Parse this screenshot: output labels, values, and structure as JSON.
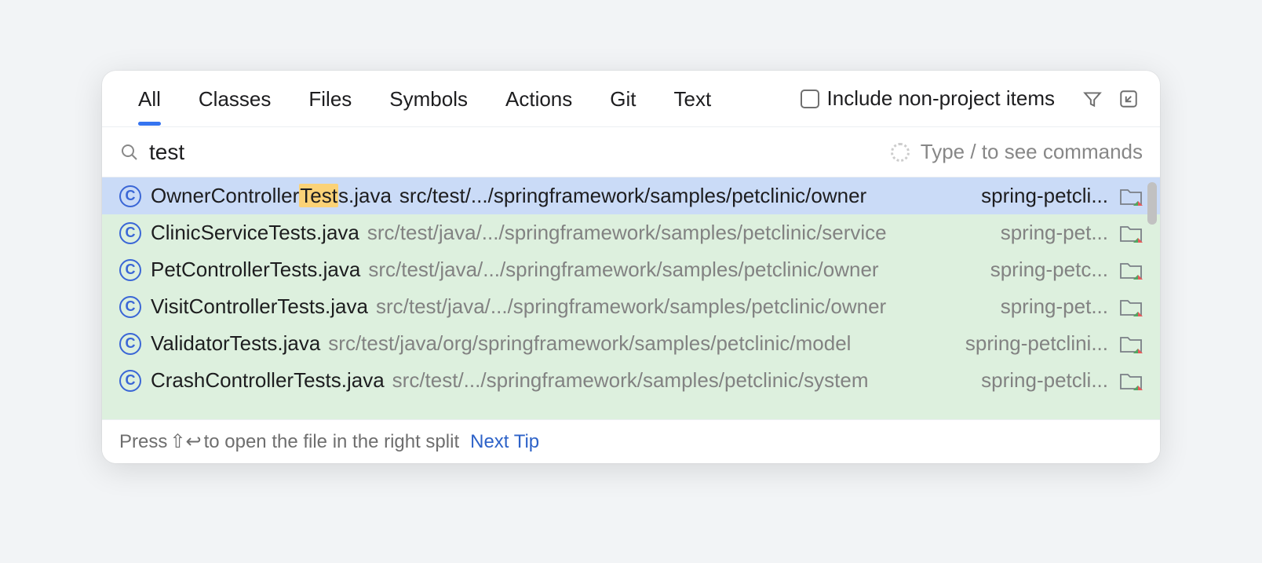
{
  "tabs": [
    "All",
    "Classes",
    "Files",
    "Symbols",
    "Actions",
    "Git",
    "Text"
  ],
  "active_tab_index": 0,
  "include_nonproject_label": "Include non-project items",
  "include_nonproject_checked": false,
  "search": {
    "value": "test",
    "hint": "Type / to see commands"
  },
  "results": [
    {
      "file_pre": "OwnerController",
      "file_match": "Test",
      "file_post": "s.java",
      "path": "src/test/.../springframework/samples/petclinic/owner",
      "module": "spring-petcli...",
      "selected": true
    },
    {
      "file_pre": "ClinicServiceTests.java",
      "file_match": "",
      "file_post": "",
      "path": "src/test/java/.../springframework/samples/petclinic/service",
      "module": "spring-pet...",
      "selected": false
    },
    {
      "file_pre": "PetControllerTests.java",
      "file_match": "",
      "file_post": "",
      "path": "src/test/java/.../springframework/samples/petclinic/owner",
      "module": "spring-petc...",
      "selected": false
    },
    {
      "file_pre": "VisitControllerTests.java",
      "file_match": "",
      "file_post": "",
      "path": "src/test/java/.../springframework/samples/petclinic/owner",
      "module": "spring-pet...",
      "selected": false
    },
    {
      "file_pre": "ValidatorTests.java",
      "file_match": "",
      "file_post": "",
      "path": "src/test/java/org/springframework/samples/petclinic/model",
      "module": "spring-petclini...",
      "selected": false
    },
    {
      "file_pre": "CrashControllerTests.java",
      "file_match": "",
      "file_post": "",
      "path": "src/test/.../springframework/samples/petclinic/system",
      "module": "spring-petcli...",
      "selected": false
    }
  ],
  "class_icon_letter": "C",
  "footer": {
    "press": "Press ",
    "keys": "⇧↩",
    "rest": " to open the file in the right split",
    "next_tip": "Next Tip"
  }
}
